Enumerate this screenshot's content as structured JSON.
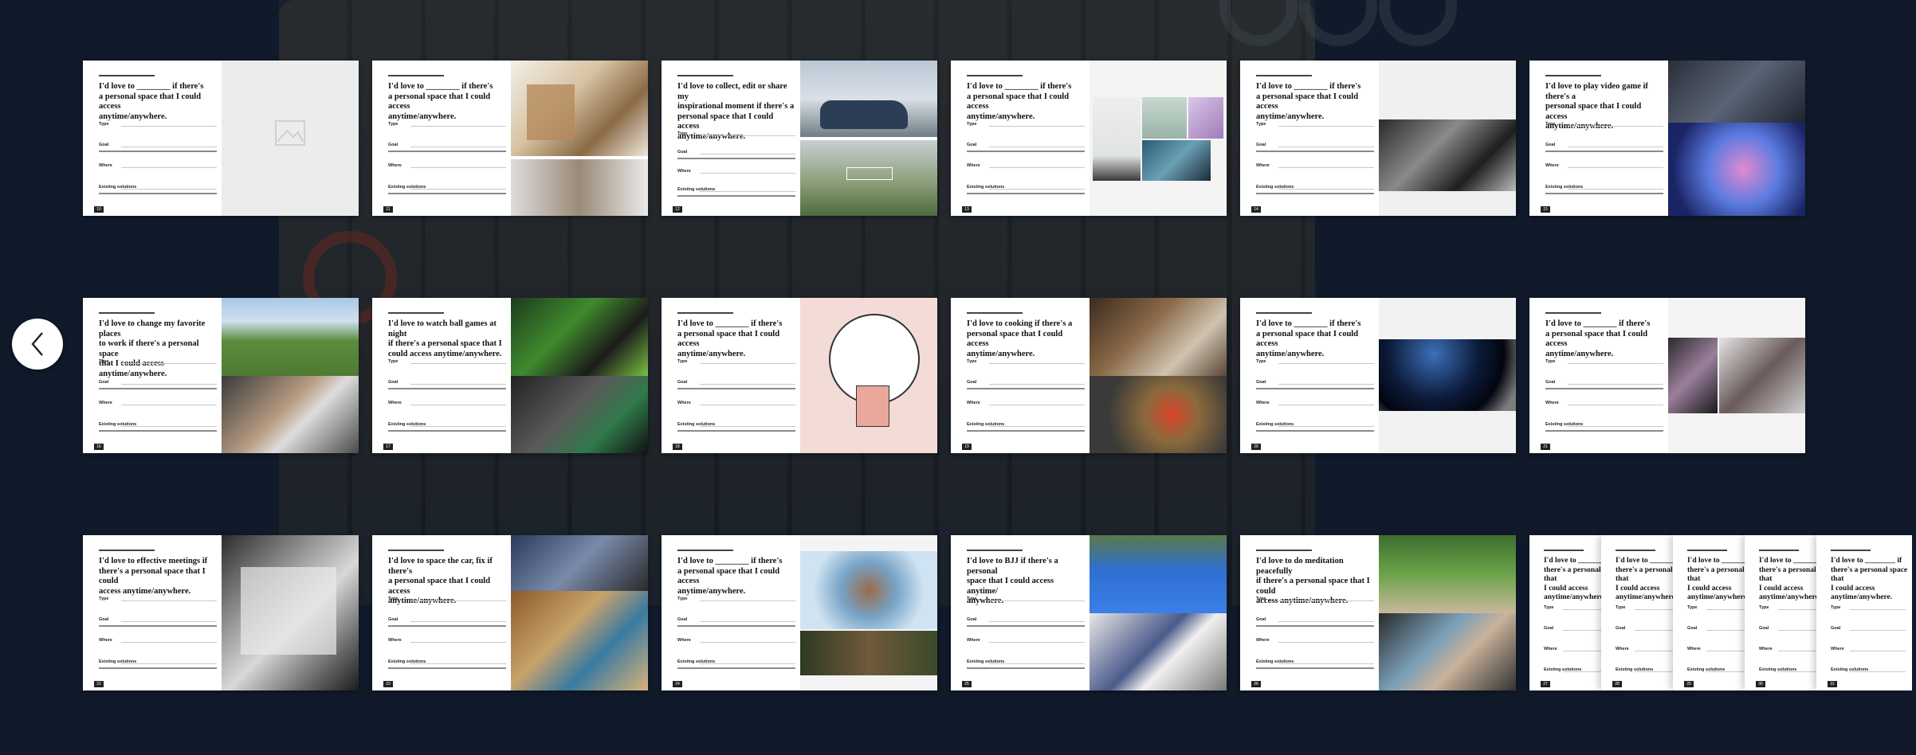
{
  "gallery": {
    "prev_icon": "chevron-left-icon",
    "slides": [
      {
        "headline": "I'd love to ________ if there's\na personal space that I could access\nanytime/anywhere.",
        "labels": [
          "Type",
          "Goal",
          "Where",
          "Existing solutions"
        ],
        "media": "image-placeholder-icon",
        "page_no": "10"
      },
      {
        "headline": "I'd love to ________ if there's\na personal space that I could access\nanytime/anywhere.",
        "labels": [
          "Type",
          "Goal",
          "Where",
          "Existing solutions"
        ],
        "media": "interior-photos",
        "page_no": "11"
      },
      {
        "headline": "I'd love to collect, edit or share my\ninspirational moment if there's a\npersonal space that I could access\nanytime/anywhere.",
        "labels": [
          "Type",
          "Goal",
          "Where",
          "Existing solutions"
        ],
        "media": "car-landscape-photos",
        "page_no": "12"
      },
      {
        "headline": "I'd love to ________ if there's\na personal space that I could access\nanytime/anywhere.",
        "labels": [
          "Type",
          "Goal",
          "Where",
          "Existing solutions"
        ],
        "media": "lifestyle-collage",
        "page_no": "13"
      },
      {
        "headline": "I'd love to ________ if there's\na personal space that I could access\nanytime/anywhere.",
        "labels": [
          "Type",
          "Goal",
          "Where",
          "Existing solutions"
        ],
        "media": "studio-photo",
        "page_no": "14"
      },
      {
        "headline": "I'd love to play video game if there's a\npersonal space that I could access\nanytime/anywhere.",
        "labels": [
          "Type",
          "Goal",
          "Where",
          "Existing solutions"
        ],
        "media": "gaming-photos",
        "page_no": "15"
      },
      {
        "headline": "I'd love to change my favorite places\nto work if there's a personal space\nthat I could access anytime/anywhere.",
        "labels": [
          "Type",
          "Goal",
          "Where",
          "Existing solutions"
        ],
        "media": "park-car-photos",
        "page_no": "16"
      },
      {
        "headline": "I'd love to watch ball games at night\nif there's a personal space that I\ncould access anytime/anywhere.",
        "labels": [
          "Type",
          "Goal",
          "Where",
          "Existing solutions"
        ],
        "media": "sports-fans-photos",
        "page_no": "17"
      },
      {
        "headline": "I'd love to ________ if there's\na personal space that I could access\nanytime/anywhere.",
        "labels": [
          "Type",
          "Goal",
          "Where",
          "Existing solutions"
        ],
        "media": "illustration",
        "page_no": "18"
      },
      {
        "headline": "I'd love to cooking if there's a\npersonal space that I could access\nanytime/anywhere.",
        "labels": [
          "Type",
          "Goal",
          "Where",
          "Existing solutions"
        ],
        "media": "cooking-photos",
        "page_no": "19"
      },
      {
        "headline": "I'd love to ________ if there's\na personal space that I could access\nanytime/anywhere.",
        "labels": [
          "Type",
          "Goal",
          "Where",
          "Existing solutions"
        ],
        "media": "space-photo",
        "page_no": "20"
      },
      {
        "headline": "I'd love to ________ if there's\na personal space that I could access\nanytime/anywhere.",
        "labels": [
          "Type",
          "Goal",
          "Where",
          "Existing solutions"
        ],
        "media": "music-photos",
        "page_no": "21"
      },
      {
        "headline": "I'd love to effective meetings if\nthere's a personal space that I could\naccess anytime/anywhere.",
        "labels": [
          "Type",
          "Goal",
          "Where",
          "Existing solutions"
        ],
        "media": "screen-photo",
        "page_no": "22"
      },
      {
        "headline": "I'd love to space the car, fix if there's\na personal space that I could access\nanytime/anywhere.",
        "labels": [
          "Type",
          "Goal",
          "Where",
          "Existing solutions"
        ],
        "media": "workshop-photos",
        "page_no": "23"
      },
      {
        "headline": "I'd love to ________ if there's\na personal space that I could access\nanytime/anywhere.",
        "labels": [
          "Type",
          "Goal",
          "Where",
          "Existing solutions"
        ],
        "media": "castle-forest-photos",
        "page_no": "24"
      },
      {
        "headline": "I'd love to BJJ if there's a personal\nspace that I could access anytime/\nanywhere.",
        "labels": [
          "Type",
          "Goal",
          "Where",
          "Existing solutions"
        ],
        "media": "bjj-photos",
        "page_no": "25"
      },
      {
        "headline": "I'd love to do meditation peacefully\nif there's a personal space that I could\naccess anytime/anywhere.",
        "labels": [
          "Type",
          "Goal",
          "Where",
          "Existing solutions"
        ],
        "media": "meditation-photos",
        "page_no": "26"
      }
    ],
    "stack": {
      "headline": "I'd love to ________ if\nthere's a personal space that\nI could access\nanytime/anywhere.",
      "labels": [
        "Type",
        "Goal",
        "Where",
        "Existing solutions"
      ],
      "page_nos": [
        "27",
        "28",
        "29",
        "30",
        "31"
      ]
    }
  },
  "colors": {
    "background": "#101a2a",
    "card": "#ffffff",
    "ink": "#111111"
  }
}
